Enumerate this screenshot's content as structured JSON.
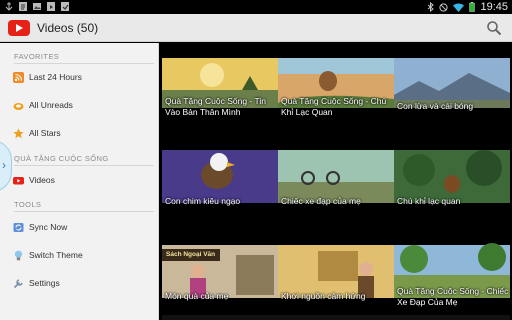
{
  "statusbar": {
    "time": "19:45"
  },
  "actionbar": {
    "title": "Videos (50)"
  },
  "sidebar": {
    "sections": [
      {
        "header": "FAVORITES",
        "items": [
          {
            "label": "Last 24 Hours",
            "icon": "rss-icon"
          },
          {
            "label": "All Unreads",
            "icon": "unread-icon"
          },
          {
            "label": "All Stars",
            "icon": "star-icon"
          }
        ]
      },
      {
        "header": "QUÀ TẶNG CUỘC SỐNG",
        "items": [
          {
            "label": "Videos",
            "icon": "youtube-icon"
          }
        ]
      },
      {
        "header": "TOOLS",
        "items": [
          {
            "label": "Sync Now",
            "icon": "sync-icon"
          },
          {
            "label": "Switch Theme",
            "icon": "lightbulb-icon"
          },
          {
            "label": "Settings",
            "icon": "wrench-icon"
          }
        ]
      }
    ],
    "handle_glyph": "›"
  },
  "videos": [
    {
      "title": "Quà Tặng Cuộc Sống - Tin Vào Bản Thân Mình"
    },
    {
      "title": "Quà Tặng Cuộc Sống - Chú Khỉ Lạc Quan"
    },
    {
      "title": "Con lừa và cái bóng"
    },
    {
      "title": "Con chim kiêu ngạo"
    },
    {
      "title": "Chiếc xe đạp của mẹ"
    },
    {
      "title": "Chú khỉ lạc quan"
    },
    {
      "title": "Món quà của mẹ"
    },
    {
      "title": "Khơi nguồn cảm hứng"
    },
    {
      "title": "Quà Tặng Cuộc Sống - Chiếc Xe Đạp Của Mẹ"
    }
  ],
  "thumb_text": {
    "sign": "Sách Ngoại Văn"
  }
}
